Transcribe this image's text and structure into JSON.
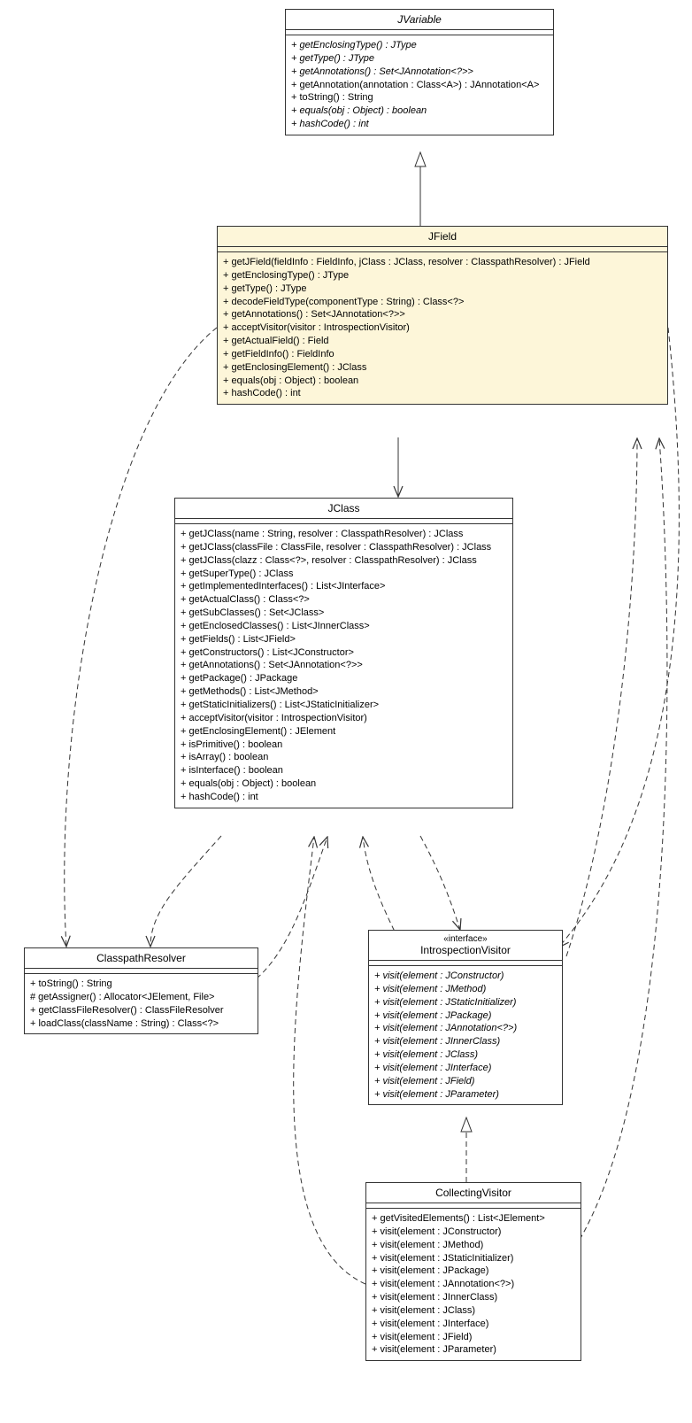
{
  "classes": {
    "jvariable": {
      "name": "JVariable",
      "titleStyle": "abstract",
      "methods": [
        {
          "text": "+ getEnclosingType() : JType",
          "italic": true
        },
        {
          "text": "+ getType() : JType",
          "italic": true
        },
        {
          "text": "+ getAnnotations() : Set<JAnnotation<?>>",
          "italic": true
        },
        {
          "text": "+ getAnnotation(annotation : Class<A>) : JAnnotation<A>"
        },
        {
          "text": "+ toString() : String"
        },
        {
          "text": "+ equals(obj : Object) : boolean",
          "italic": true
        },
        {
          "text": "+ hashCode() : int",
          "italic": true
        }
      ]
    },
    "jfield": {
      "name": "JField",
      "methods": [
        {
          "text": "+ getJField(fieldInfo : FieldInfo, jClass : JClass, resolver : ClasspathResolver) : JField"
        },
        {
          "text": "+ getEnclosingType() : JType"
        },
        {
          "text": "+ getType() : JType"
        },
        {
          "text": "+ decodeFieldType(componentType : String) : Class<?>"
        },
        {
          "text": "+ getAnnotations() : Set<JAnnotation<?>>"
        },
        {
          "text": "+ acceptVisitor(visitor : IntrospectionVisitor)"
        },
        {
          "text": "+ getActualField() : Field"
        },
        {
          "text": "+ getFieldInfo() : FieldInfo"
        },
        {
          "text": "+ getEnclosingElement() : JClass"
        },
        {
          "text": "+ equals(obj : Object) : boolean"
        },
        {
          "text": "+ hashCode() : int"
        }
      ]
    },
    "jclass": {
      "name": "JClass",
      "methods": [
        {
          "text": "+ getJClass(name : String, resolver : ClasspathResolver) : JClass"
        },
        {
          "text": "+ getJClass(classFile : ClassFile, resolver : ClasspathResolver) : JClass"
        },
        {
          "text": "+ getJClass(clazz : Class<?>, resolver : ClasspathResolver) : JClass"
        },
        {
          "text": "+ getSuperType() : JClass"
        },
        {
          "text": "+ getImplementedInterfaces() : List<JInterface>"
        },
        {
          "text": "+ getActualClass() : Class<?>"
        },
        {
          "text": "+ getSubClasses() : Set<JClass>"
        },
        {
          "text": "+ getEnclosedClasses() : List<JInnerClass>"
        },
        {
          "text": "+ getFields() : List<JField>"
        },
        {
          "text": "+ getConstructors() : List<JConstructor>"
        },
        {
          "text": "+ getAnnotations() : Set<JAnnotation<?>>"
        },
        {
          "text": "+ getPackage() : JPackage"
        },
        {
          "text": "+ getMethods() : List<JMethod>"
        },
        {
          "text": "+ getStaticInitializers() : List<JStaticInitializer>"
        },
        {
          "text": "+ acceptVisitor(visitor : IntrospectionVisitor)"
        },
        {
          "text": "+ getEnclosingElement() : JElement"
        },
        {
          "text": "+ isPrimitive() : boolean"
        },
        {
          "text": "+ isArray() : boolean"
        },
        {
          "text": "+ isInterface() : boolean"
        },
        {
          "text": "+ equals(obj : Object) : boolean"
        },
        {
          "text": "+ hashCode() : int"
        }
      ]
    },
    "classpathresolver": {
      "name": "ClasspathResolver",
      "methods": [
        {
          "text": "+ toString() : String"
        },
        {
          "text": "# getAssigner() : Allocator<JElement, File>"
        },
        {
          "text": "+ getClassFileResolver() : ClassFileResolver"
        },
        {
          "text": "+ loadClass(className : String) : Class<?>"
        }
      ]
    },
    "introspectionvisitor": {
      "name": "IntrospectionVisitor",
      "stereotype": "«interface»",
      "methods": [
        {
          "text": "+ visit(element : JConstructor)",
          "italic": true
        },
        {
          "text": "+ visit(element : JMethod)",
          "italic": true
        },
        {
          "text": "+ visit(element : JStaticInitializer)",
          "italic": true
        },
        {
          "text": "+ visit(element : JPackage)",
          "italic": true
        },
        {
          "text": "+ visit(element : JAnnotation<?>)",
          "italic": true
        },
        {
          "text": "+ visit(element : JInnerClass)",
          "italic": true
        },
        {
          "text": "+ visit(element : JClass)",
          "italic": true
        },
        {
          "text": "+ visit(element : JInterface)",
          "italic": true
        },
        {
          "text": "+ visit(element : JField)",
          "italic": true
        },
        {
          "text": "+ visit(element : JParameter)",
          "italic": true
        }
      ]
    },
    "collectingvisitor": {
      "name": "CollectingVisitor",
      "methods": [
        {
          "text": "+ getVisitedElements() : List<JElement>"
        },
        {
          "text": "+ visit(element : JConstructor)"
        },
        {
          "text": "+ visit(element : JMethod)"
        },
        {
          "text": "+ visit(element : JStaticInitializer)"
        },
        {
          "text": "+ visit(element : JPackage)"
        },
        {
          "text": "+ visit(element : JAnnotation<?>)"
        },
        {
          "text": "+ visit(element : JInnerClass)"
        },
        {
          "text": "+ visit(element : JClass)"
        },
        {
          "text": "+ visit(element : JInterface)"
        },
        {
          "text": "+ visit(element : JField)"
        },
        {
          "text": "+ visit(element : JParameter)"
        }
      ]
    }
  }
}
